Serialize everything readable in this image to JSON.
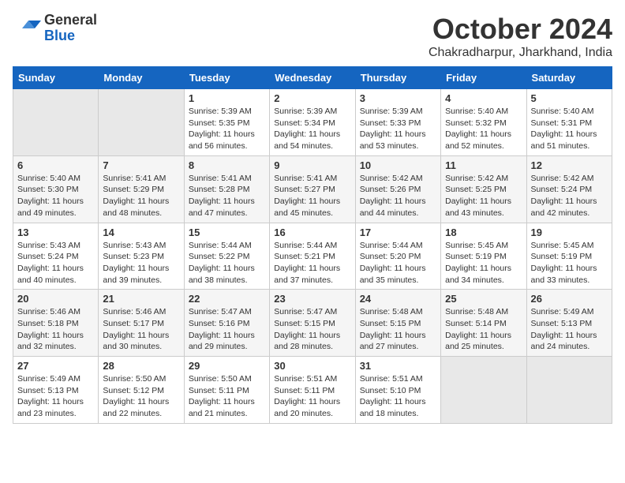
{
  "header": {
    "logo_general": "General",
    "logo_blue": "Blue",
    "month_title": "October 2024",
    "subtitle": "Chakradharpur, Jharkhand, India"
  },
  "weekdays": [
    "Sunday",
    "Monday",
    "Tuesday",
    "Wednesday",
    "Thursday",
    "Friday",
    "Saturday"
  ],
  "weeks": [
    [
      null,
      null,
      {
        "day": "1",
        "sunrise": "Sunrise: 5:39 AM",
        "sunset": "Sunset: 5:35 PM",
        "daylight": "Daylight: 11 hours and 56 minutes."
      },
      {
        "day": "2",
        "sunrise": "Sunrise: 5:39 AM",
        "sunset": "Sunset: 5:34 PM",
        "daylight": "Daylight: 11 hours and 54 minutes."
      },
      {
        "day": "3",
        "sunrise": "Sunrise: 5:39 AM",
        "sunset": "Sunset: 5:33 PM",
        "daylight": "Daylight: 11 hours and 53 minutes."
      },
      {
        "day": "4",
        "sunrise": "Sunrise: 5:40 AM",
        "sunset": "Sunset: 5:32 PM",
        "daylight": "Daylight: 11 hours and 52 minutes."
      },
      {
        "day": "5",
        "sunrise": "Sunrise: 5:40 AM",
        "sunset": "Sunset: 5:31 PM",
        "daylight": "Daylight: 11 hours and 51 minutes."
      }
    ],
    [
      {
        "day": "6",
        "sunrise": "Sunrise: 5:40 AM",
        "sunset": "Sunset: 5:30 PM",
        "daylight": "Daylight: 11 hours and 49 minutes."
      },
      {
        "day": "7",
        "sunrise": "Sunrise: 5:41 AM",
        "sunset": "Sunset: 5:29 PM",
        "daylight": "Daylight: 11 hours and 48 minutes."
      },
      {
        "day": "8",
        "sunrise": "Sunrise: 5:41 AM",
        "sunset": "Sunset: 5:28 PM",
        "daylight": "Daylight: 11 hours and 47 minutes."
      },
      {
        "day": "9",
        "sunrise": "Sunrise: 5:41 AM",
        "sunset": "Sunset: 5:27 PM",
        "daylight": "Daylight: 11 hours and 45 minutes."
      },
      {
        "day": "10",
        "sunrise": "Sunrise: 5:42 AM",
        "sunset": "Sunset: 5:26 PM",
        "daylight": "Daylight: 11 hours and 44 minutes."
      },
      {
        "day": "11",
        "sunrise": "Sunrise: 5:42 AM",
        "sunset": "Sunset: 5:25 PM",
        "daylight": "Daylight: 11 hours and 43 minutes."
      },
      {
        "day": "12",
        "sunrise": "Sunrise: 5:42 AM",
        "sunset": "Sunset: 5:24 PM",
        "daylight": "Daylight: 11 hours and 42 minutes."
      }
    ],
    [
      {
        "day": "13",
        "sunrise": "Sunrise: 5:43 AM",
        "sunset": "Sunset: 5:24 PM",
        "daylight": "Daylight: 11 hours and 40 minutes."
      },
      {
        "day": "14",
        "sunrise": "Sunrise: 5:43 AM",
        "sunset": "Sunset: 5:23 PM",
        "daylight": "Daylight: 11 hours and 39 minutes."
      },
      {
        "day": "15",
        "sunrise": "Sunrise: 5:44 AM",
        "sunset": "Sunset: 5:22 PM",
        "daylight": "Daylight: 11 hours and 38 minutes."
      },
      {
        "day": "16",
        "sunrise": "Sunrise: 5:44 AM",
        "sunset": "Sunset: 5:21 PM",
        "daylight": "Daylight: 11 hours and 37 minutes."
      },
      {
        "day": "17",
        "sunrise": "Sunrise: 5:44 AM",
        "sunset": "Sunset: 5:20 PM",
        "daylight": "Daylight: 11 hours and 35 minutes."
      },
      {
        "day": "18",
        "sunrise": "Sunrise: 5:45 AM",
        "sunset": "Sunset: 5:19 PM",
        "daylight": "Daylight: 11 hours and 34 minutes."
      },
      {
        "day": "19",
        "sunrise": "Sunrise: 5:45 AM",
        "sunset": "Sunset: 5:19 PM",
        "daylight": "Daylight: 11 hours and 33 minutes."
      }
    ],
    [
      {
        "day": "20",
        "sunrise": "Sunrise: 5:46 AM",
        "sunset": "Sunset: 5:18 PM",
        "daylight": "Daylight: 11 hours and 32 minutes."
      },
      {
        "day": "21",
        "sunrise": "Sunrise: 5:46 AM",
        "sunset": "Sunset: 5:17 PM",
        "daylight": "Daylight: 11 hours and 30 minutes."
      },
      {
        "day": "22",
        "sunrise": "Sunrise: 5:47 AM",
        "sunset": "Sunset: 5:16 PM",
        "daylight": "Daylight: 11 hours and 29 minutes."
      },
      {
        "day": "23",
        "sunrise": "Sunrise: 5:47 AM",
        "sunset": "Sunset: 5:15 PM",
        "daylight": "Daylight: 11 hours and 28 minutes."
      },
      {
        "day": "24",
        "sunrise": "Sunrise: 5:48 AM",
        "sunset": "Sunset: 5:15 PM",
        "daylight": "Daylight: 11 hours and 27 minutes."
      },
      {
        "day": "25",
        "sunrise": "Sunrise: 5:48 AM",
        "sunset": "Sunset: 5:14 PM",
        "daylight": "Daylight: 11 hours and 25 minutes."
      },
      {
        "day": "26",
        "sunrise": "Sunrise: 5:49 AM",
        "sunset": "Sunset: 5:13 PM",
        "daylight": "Daylight: 11 hours and 24 minutes."
      }
    ],
    [
      {
        "day": "27",
        "sunrise": "Sunrise: 5:49 AM",
        "sunset": "Sunset: 5:13 PM",
        "daylight": "Daylight: 11 hours and 23 minutes."
      },
      {
        "day": "28",
        "sunrise": "Sunrise: 5:50 AM",
        "sunset": "Sunset: 5:12 PM",
        "daylight": "Daylight: 11 hours and 22 minutes."
      },
      {
        "day": "29",
        "sunrise": "Sunrise: 5:50 AM",
        "sunset": "Sunset: 5:11 PM",
        "daylight": "Daylight: 11 hours and 21 minutes."
      },
      {
        "day": "30",
        "sunrise": "Sunrise: 5:51 AM",
        "sunset": "Sunset: 5:11 PM",
        "daylight": "Daylight: 11 hours and 20 minutes."
      },
      {
        "day": "31",
        "sunrise": "Sunrise: 5:51 AM",
        "sunset": "Sunset: 5:10 PM",
        "daylight": "Daylight: 11 hours and 18 minutes."
      },
      null,
      null
    ]
  ]
}
